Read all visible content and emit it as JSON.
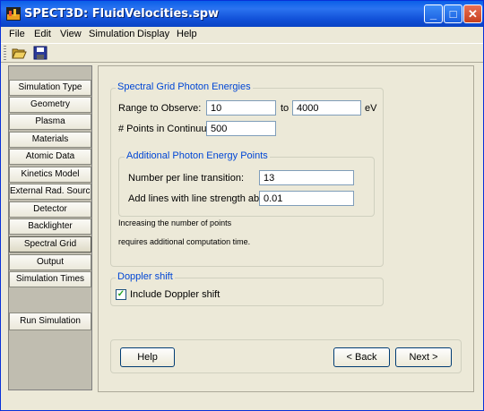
{
  "window": {
    "title": "SPECT3D:  FluidVelocities.spw"
  },
  "menu": [
    "File",
    "Edit",
    "View",
    "Simulation",
    "Display",
    "Help"
  ],
  "sidebar": {
    "items": [
      {
        "label": "Simulation Type"
      },
      {
        "label": "Geometry"
      },
      {
        "label": "Plasma"
      },
      {
        "label": "Materials"
      },
      {
        "label": "Atomic Data"
      },
      {
        "label": "Kinetics Model"
      },
      {
        "label": "External Rad. Source"
      },
      {
        "label": "Detector"
      },
      {
        "label": "Backlighter"
      },
      {
        "label": "Spectral Grid"
      },
      {
        "label": "Output"
      },
      {
        "label": "Simulation Times"
      }
    ],
    "active": "Spectral Grid",
    "run_label": "Run Simulation"
  },
  "spectral": {
    "group_title": "Spectral Grid Photon Energies",
    "range_label": "Range to Observe:",
    "range_from": "10",
    "to_label": "to",
    "range_to": "4000",
    "unit": "eV",
    "points_label": "# Points in Continuum:",
    "points_value": "500",
    "additional": {
      "title": "Additional Photon Energy Points",
      "per_line_label": "Number per line transition:",
      "per_line_value": "13",
      "strength_label": "Add lines with line strength above:",
      "strength_value": "0.01"
    },
    "note_line1": "Increasing the number of points",
    "note_line2": "requires additional computation time."
  },
  "doppler": {
    "title": "Doppler shift",
    "checkbox_label": "Include Doppler shift",
    "checked": true
  },
  "footer": {
    "help": "Help",
    "back": "< Back",
    "next": "Next >"
  }
}
